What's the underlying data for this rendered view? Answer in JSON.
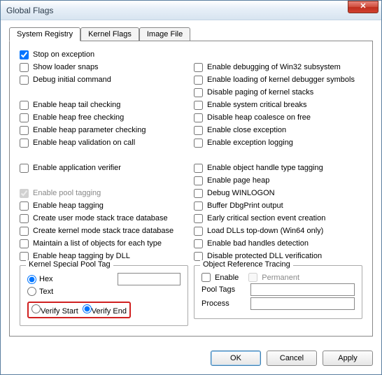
{
  "window": {
    "title": "Global Flags"
  },
  "tabs": {
    "system_registry": "System Registry",
    "kernel_flags": "Kernel Flags",
    "image_file": "Image File"
  },
  "left": {
    "stop_exception": "Stop on exception",
    "show_loader": "Show loader snaps",
    "debug_init": "Debug initial command",
    "heap_tail": "Enable heap tail checking",
    "heap_free": "Enable heap free checking",
    "heap_param": "Enable heap parameter checking",
    "heap_valid": "Enable heap validation on call",
    "app_verif": "Enable application verifier",
    "pool_tag": "Enable pool tagging",
    "heap_tagging": "Enable heap tagging",
    "user_stack": "Create user mode stack trace database",
    "kernel_stack": "Create kernel mode stack trace database",
    "obj_list": "Maintain a list of objects for each type",
    "heap_dll": "Enable heap tagging by DLL"
  },
  "right": {
    "dbg_win32": "Enable debugging of Win32 subsystem",
    "dbg_symbols": "Enable loading of kernel debugger symbols",
    "paging": "Disable paging of kernel stacks",
    "crit_breaks": "Enable system critical breaks",
    "coalesce": "Disable heap coalesce on free",
    "close_exc": "Enable close exception",
    "exc_log": "Enable exception logging",
    "obj_type": "Enable object handle type tagging",
    "page_heap": "Enable page heap",
    "winlogon": "Debug WINLOGON",
    "dbgprint": "Buffer DbgPrint output",
    "early_crit": "Early critical section event creation",
    "topdown": "Load DLLs top-down (Win64 only)",
    "bad_handles": "Enable bad handles detection",
    "prot_dll": "Disable protected DLL verification"
  },
  "kspt": {
    "legend": "Kernel Special Pool Tag",
    "hex": "Hex",
    "text": "Text",
    "verify_start": "Verify Start",
    "verify_end": "Verify End",
    "value": ""
  },
  "ort": {
    "legend": "Object Reference Tracing",
    "enable": "Enable",
    "permanent": "Permanent",
    "pool_tags": "Pool Tags",
    "process": "Process",
    "pool_tags_val": "",
    "process_val": ""
  },
  "checked": {
    "stop_exception": true,
    "pool_tag": true
  },
  "buttons": {
    "ok": "OK",
    "cancel": "Cancel",
    "apply": "Apply"
  }
}
